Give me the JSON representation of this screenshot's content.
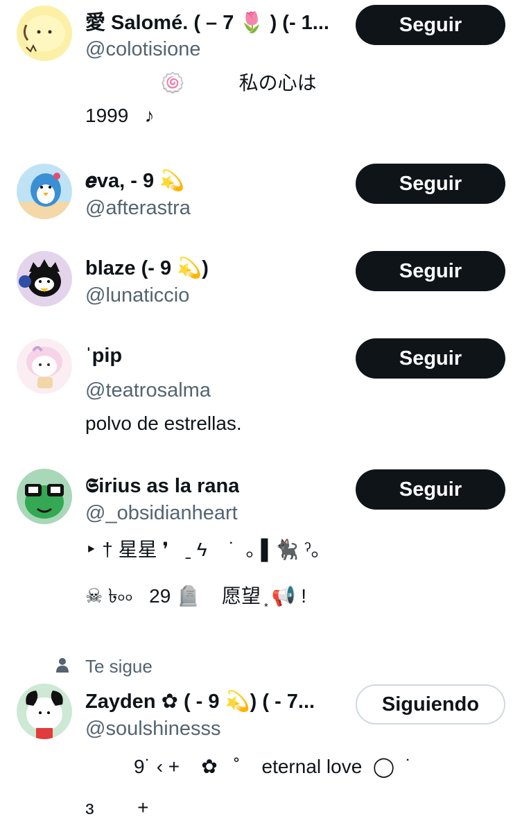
{
  "users": [
    {
      "name": "愛 Salomé. ( – 7 🌷 ) (- 1...",
      "handle": "@colotisione",
      "button": "Seguir",
      "bio": [
        "              🍥          私の心は",
        "1999   ♪"
      ]
    },
    {
      "name": "𝒆va, - 9 💫",
      "handle": "@afterastra",
      "button": "Seguir",
      "bio": []
    },
    {
      "name": "blaze (- 9 💫)",
      "handle": "@lunaticcio",
      "button": "Seguir",
      "bio": []
    },
    {
      "name": "ˈpip",
      "handle": "@teatrosalma",
      "button": "Seguir",
      "bio": [
        "polvo de estrellas."
      ]
    },
    {
      "name": "𝕾irius as la rana",
      "handle": "@_obsidianheart",
      "button": "Seguir",
      "bio": [
        "‣ † 星星 ❜   ˍ ϟ    ˙  ｡ ▌🐈‍⬛ ˀ｡",
        "☠︎ ৳৹৹   29 🪦    愿望 ͙ 📢 !"
      ]
    },
    {
      "follows_you": "Te sigue",
      "name": "Zayden ✿ ( - 9 💫) ( - 7...",
      "handle": "@soulshinesss",
      "button": "Siguiendo",
      "bio": [
        "         9˙ ‹ +    ✿   ˚    eternal love  ◯  ˙",
        "ɜ        +"
      ]
    }
  ],
  "colors": {
    "text": "#0f1419",
    "secondary": "#536471",
    "button_bg": "#0f1419",
    "border": "#cfd9de"
  }
}
